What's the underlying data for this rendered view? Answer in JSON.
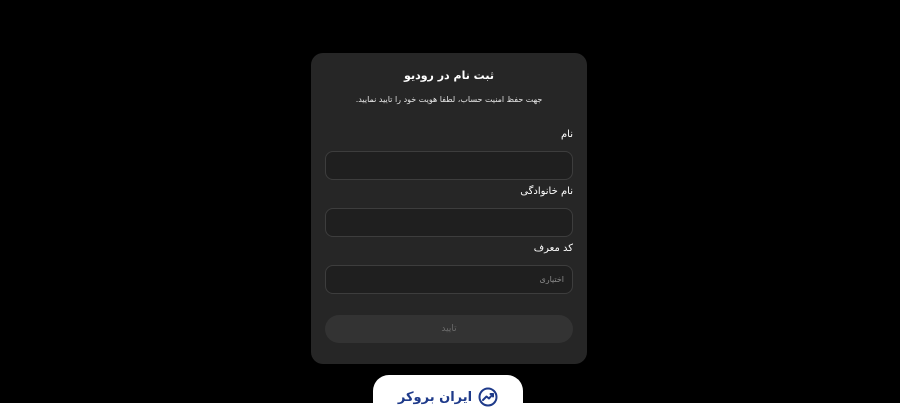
{
  "form": {
    "title": "ثبت نام در رودیو",
    "subtitle": "جهت حفظ امنیت حساب، لطفا هویت خود را تایید نمایید.",
    "first_name": {
      "label": "نام",
      "value": "",
      "placeholder": ""
    },
    "last_name": {
      "label": "نام خانوادگی",
      "value": "",
      "placeholder": ""
    },
    "referral_code": {
      "label": "کد معرف",
      "value": "",
      "placeholder": "اختیاری"
    },
    "submit_label": "تایید"
  },
  "footer": {
    "brand_name": "ایران بروکر",
    "brand_icon": "trend-chart-icon"
  },
  "colors": {
    "background": "#000000",
    "card": "#262626",
    "brand": "#1e3a8a"
  }
}
